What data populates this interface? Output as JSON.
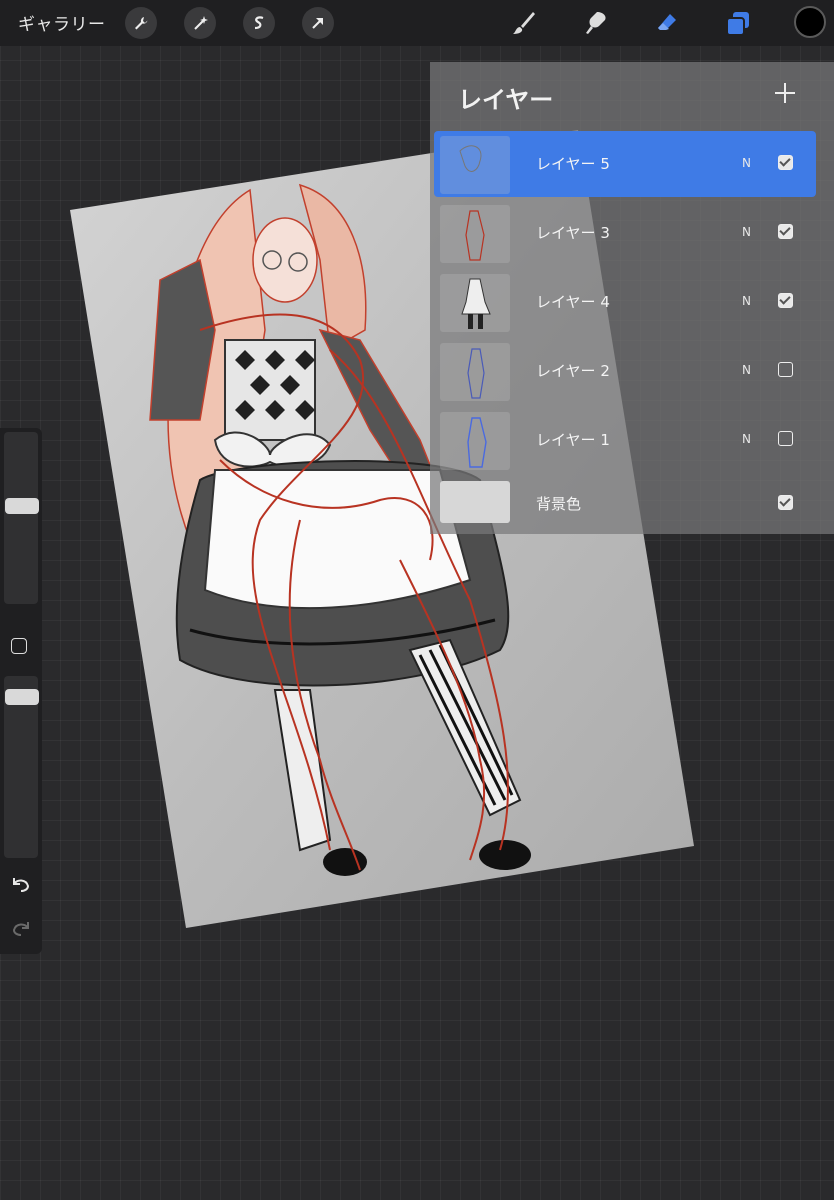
{
  "toolbar": {
    "gallery_label": "ギャラリー",
    "action_icons": [
      "wrench-icon",
      "magic-wand-icon",
      "selection-icon",
      "transform-arrow-icon"
    ],
    "tool_icons": [
      "brush-icon",
      "smudge-icon",
      "eraser-icon",
      "layers-icon"
    ],
    "active_tool": "eraser",
    "accent_color": "#3f7be6",
    "current_color": "#000000"
  },
  "layers_panel": {
    "title": "レイヤー",
    "add_label": "+",
    "layers": [
      {
        "name": "レイヤー 5",
        "mode": "N",
        "visible": true,
        "selected": true
      },
      {
        "name": "レイヤー 3",
        "mode": "N",
        "visible": true,
        "selected": false
      },
      {
        "name": "レイヤー 4",
        "mode": "N",
        "visible": true,
        "selected": false
      },
      {
        "name": "レイヤー 2",
        "mode": "N",
        "visible": false,
        "selected": false
      },
      {
        "name": "レイヤー 1",
        "mode": "N",
        "visible": false,
        "selected": false
      }
    ],
    "background": {
      "name": "背景色",
      "visible": true
    }
  },
  "sidebar": {
    "brush_size_level": 0.58,
    "opacity_level": 0.92,
    "icons": [
      "modifier-square-icon",
      "undo-icon",
      "redo-icon"
    ]
  }
}
